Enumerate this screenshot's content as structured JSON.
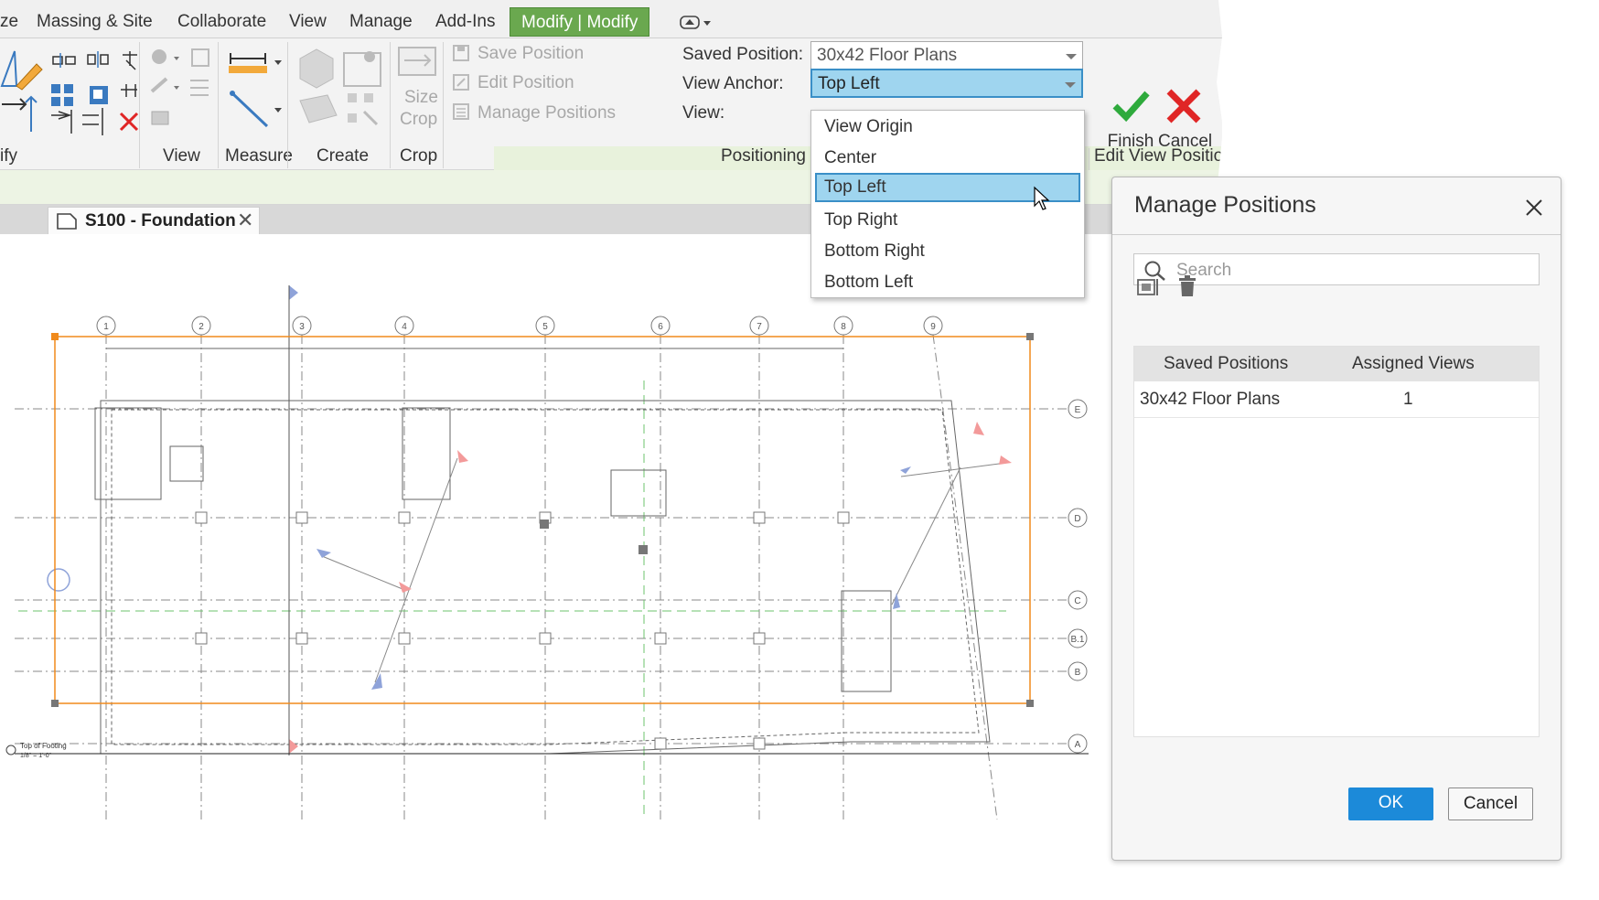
{
  "ribbon_tabs": [
    "ze",
    "Massing & Site",
    "Collaborate",
    "View",
    "Manage",
    "Add-Ins"
  ],
  "active_tab": "Modify | Modify",
  "panels": {
    "modify": "ify",
    "view": "View",
    "measure": "Measure",
    "create": "Create",
    "crop": "Crop",
    "positioning": "Positioning a",
    "edit_view_positions": "Edit View Position"
  },
  "crop_buttons": {
    "size_crop": "Size",
    "size_crop_2": "Crop"
  },
  "positioning_buttons": {
    "save_position": "Save Position",
    "edit_position": "Edit Position",
    "manage_positions": "Manage Positions"
  },
  "fields": {
    "saved_position_label": "Saved Position:",
    "saved_position_value": "30x42 Floor Plans",
    "view_anchor_label": "View Anchor:",
    "view_anchor_value": "Top Left",
    "view_label": "View:"
  },
  "anchor_options": [
    "View Origin",
    "Center",
    "Top Left",
    "Top Right",
    "Bottom Right",
    "Bottom Left"
  ],
  "selected_anchor": "Top Left",
  "finish_cancel": {
    "finish": "Finish",
    "cancel": "Cancel"
  },
  "document_tab": "S100 - Foundation",
  "grid_columns": [
    "1",
    "2",
    "3",
    "4",
    "5",
    "6",
    "7",
    "8",
    "9"
  ],
  "grid_rows": [
    "E",
    "D",
    "C",
    "B.1",
    "B",
    "A"
  ],
  "level_label": "Top of Footing",
  "level_scale": "1/8\" = 1'-0\"",
  "dialog": {
    "title": "Manage Positions",
    "search_placeholder": "Search",
    "columns": [
      "Saved Positions",
      "Assigned Views"
    ],
    "rows": [
      {
        "position": "30x42 Floor Plans",
        "views": "1"
      }
    ],
    "ok": "OK",
    "cancel": "Cancel"
  },
  "colors": {
    "active_tab": "#6aa84f",
    "selection": "#9fd5ef",
    "ok_button": "#1c8ad9",
    "crop_region": "#f08a1c",
    "finish_check": "#2eaa3c",
    "cancel_x": "#e02626"
  }
}
